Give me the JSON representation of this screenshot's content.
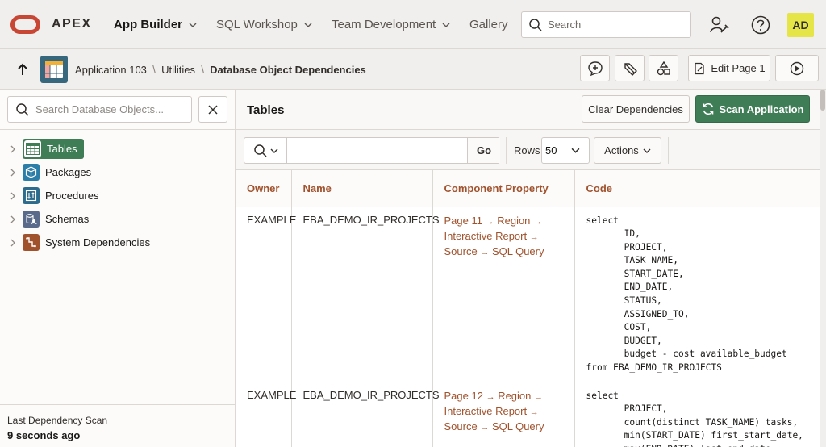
{
  "header": {
    "brand": "APEX",
    "nav": [
      {
        "label": "App Builder",
        "active": true
      },
      {
        "label": "SQL Workshop",
        "active": false
      },
      {
        "label": "Team Development",
        "active": false
      },
      {
        "label": "Gallery",
        "active": false
      }
    ],
    "search_placeholder": "Search",
    "avatar_initials": "AD",
    "avatar_color": "#e5e548"
  },
  "breadcrumb": {
    "items": [
      "Application 103",
      "Utilities",
      "Database Object Dependencies"
    ],
    "edit_page_label": "Edit Page 1"
  },
  "left": {
    "search_placeholder": "Search Database Objects...",
    "tree": [
      {
        "label": "Tables",
        "selected": true
      },
      {
        "label": "Packages",
        "selected": false
      },
      {
        "label": "Procedures",
        "selected": false
      },
      {
        "label": "Schemas",
        "selected": false
      },
      {
        "label": "System Dependencies",
        "selected": false
      }
    ],
    "footer_label": "Last Dependency Scan",
    "footer_value": "9 seconds ago"
  },
  "main": {
    "title": "Tables",
    "clear_label": "Clear Dependencies",
    "scan_label": "Scan Application",
    "toolbar": {
      "go_label": "Go",
      "rows_label": "Rows",
      "rows_value": "50",
      "actions_label": "Actions"
    },
    "columns": [
      "Owner",
      "Name",
      "Component Property",
      "Code"
    ],
    "rows": [
      {
        "owner": "EXAMPLE",
        "name": "EBA_DEMO_IR_PROJECTS",
        "prop": [
          "Page 11",
          "Region",
          "Interactive Report",
          "Source",
          "SQL Query"
        ],
        "code": "select\n       ID,\n       PROJECT,\n       TASK_NAME,\n       START_DATE,\n       END_DATE,\n       STATUS,\n       ASSIGNED_TO,\n       COST,\n       BUDGET,\n       budget - cost available_budget\nfrom EBA_DEMO_IR_PROJECTS"
      },
      {
        "owner": "EXAMPLE",
        "name": "EBA_DEMO_IR_PROJECTS",
        "prop": [
          "Page 12",
          "Region",
          "Interactive Report",
          "Source",
          "SQL Query"
        ],
        "code": "select\n       PROJECT,\n       count(distinct TASK_NAME) tasks,\n       min(START_DATE) first_start_date,\n       max(END_DATE) last_end_date,"
      }
    ]
  },
  "colors": {
    "accent_green": "#3f7d56",
    "link_rust": "#a0522d",
    "oracle_red": "#c74634"
  }
}
